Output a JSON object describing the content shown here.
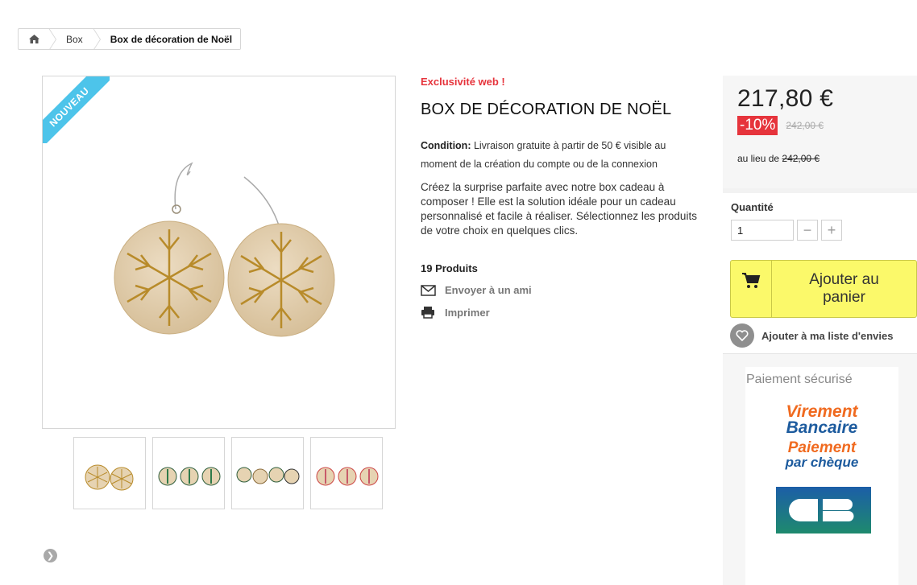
{
  "breadcrumb": {
    "home_icon": "home-icon",
    "items": [
      "Box",
      "Box de décoration de Noël"
    ]
  },
  "product": {
    "ribbon": "NOUVEAU",
    "exclusive": "Exclusivité web !",
    "title": "BOX DE DÉCORATION DE NOËL",
    "condition_label": "Condition:",
    "condition_text": " Livraison gratuite à partir de 50 € visible au moment de la création du compte ou de la connexion",
    "description": "Créez la surprise parfaite avec notre box cadeau à composer ! Elle est la solution idéale pour un cadeau personnalisé et facile à réaliser. Sélectionnez les produits de votre choix en quelques clics.",
    "count": "19 Produits",
    "send_friend": "Envoyer à un ami",
    "print": "Imprimer"
  },
  "pricing": {
    "price": "217,80 €",
    "discount": "-10%",
    "old_price": "242,00 €",
    "instead_label": "au lieu de ",
    "instead_price": "242,00 €"
  },
  "quantity": {
    "label": "Quantité",
    "value": "1",
    "minus": "−",
    "plus": "+"
  },
  "cart": {
    "label_line1": "Ajouter au",
    "label_line2": "panier"
  },
  "wishlist": {
    "label": "Ajouter à ma liste d'envies"
  },
  "payment": {
    "title": "Paiement sécurisé",
    "virement_1": "Virement",
    "virement_2": "Bancaire",
    "cheque_1": "Paiement",
    "cheque_2": "par chèque",
    "cb": "CB"
  },
  "colors": {
    "accent_red": "#e6343c",
    "ribbon_blue": "#4dc4ea",
    "cart_yellow": "#fbf96a"
  }
}
